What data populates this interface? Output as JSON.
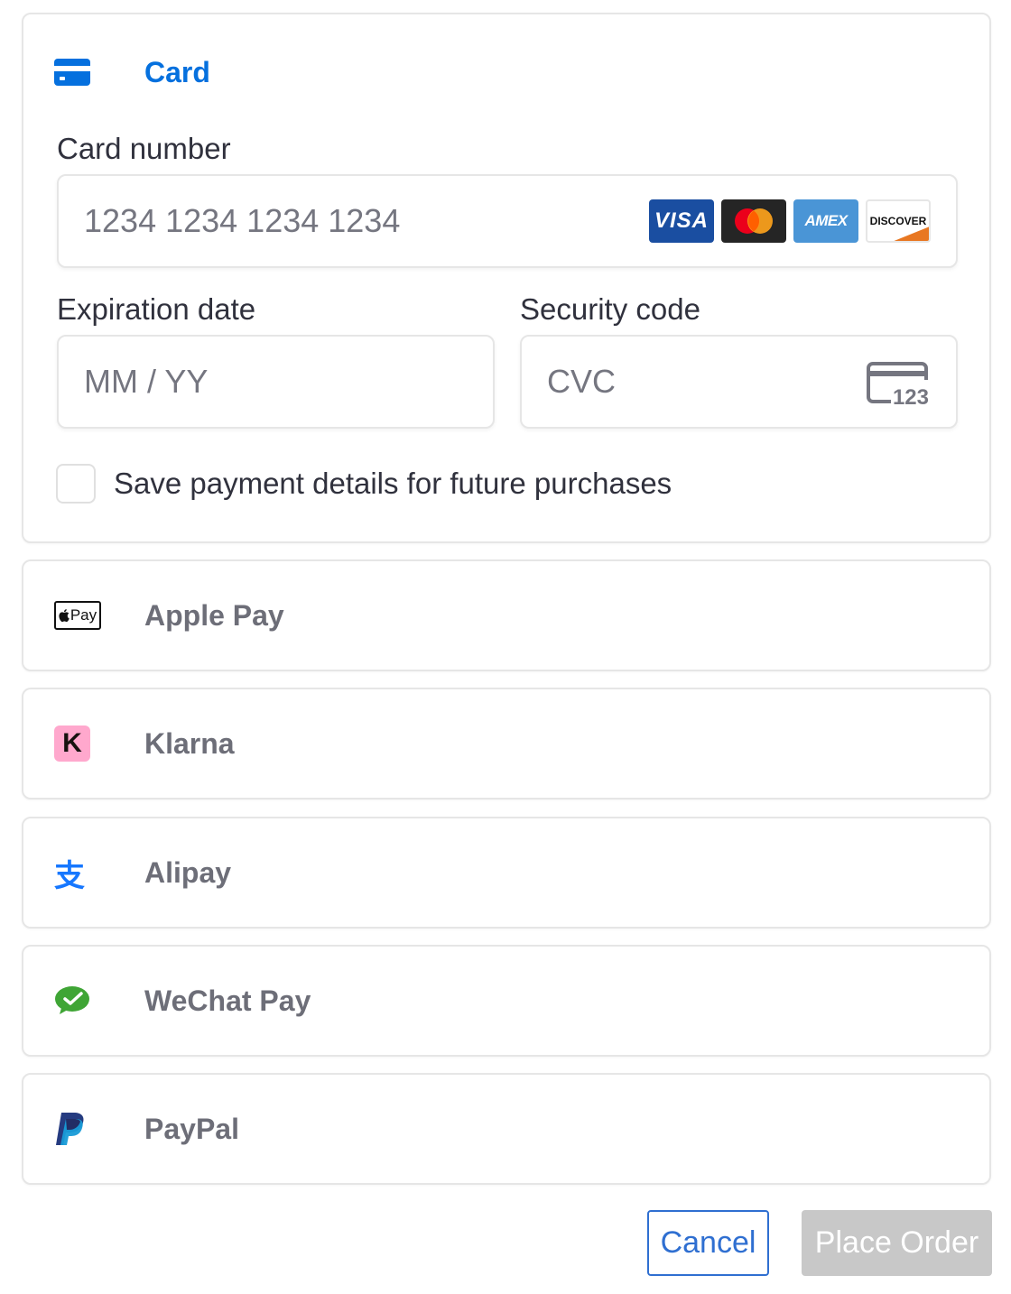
{
  "card": {
    "title": "Card",
    "card_number_label": "Card number",
    "card_number_placeholder": "1234 1234 1234 1234",
    "expiration_label": "Expiration date",
    "expiration_placeholder": "MM / YY",
    "security_label": "Security code",
    "security_placeholder": "CVC",
    "cvc_icon_text": "123",
    "save_label": "Save payment details for future purchases",
    "save_checked": false,
    "brands": [
      "VISA",
      "AMEX",
      "DISCOVER"
    ],
    "accent_color": "#0570de"
  },
  "methods": [
    {
      "label": "Apple Pay",
      "icon": "apple-pay-icon",
      "icon_text": "Pay"
    },
    {
      "label": "Klarna",
      "icon": "klarna-icon",
      "icon_text": "K"
    },
    {
      "label": "Alipay",
      "icon": "alipay-icon",
      "icon_text": "支"
    },
    {
      "label": "WeChat Pay",
      "icon": "wechat-pay-icon"
    },
    {
      "label": "PayPal",
      "icon": "paypal-icon"
    }
  ],
  "actions": {
    "cancel_label": "Cancel",
    "place_order_label": "Place Order",
    "cancel_color": "#2f6fd1",
    "place_order_disabled_color": "#c8c8c8"
  }
}
